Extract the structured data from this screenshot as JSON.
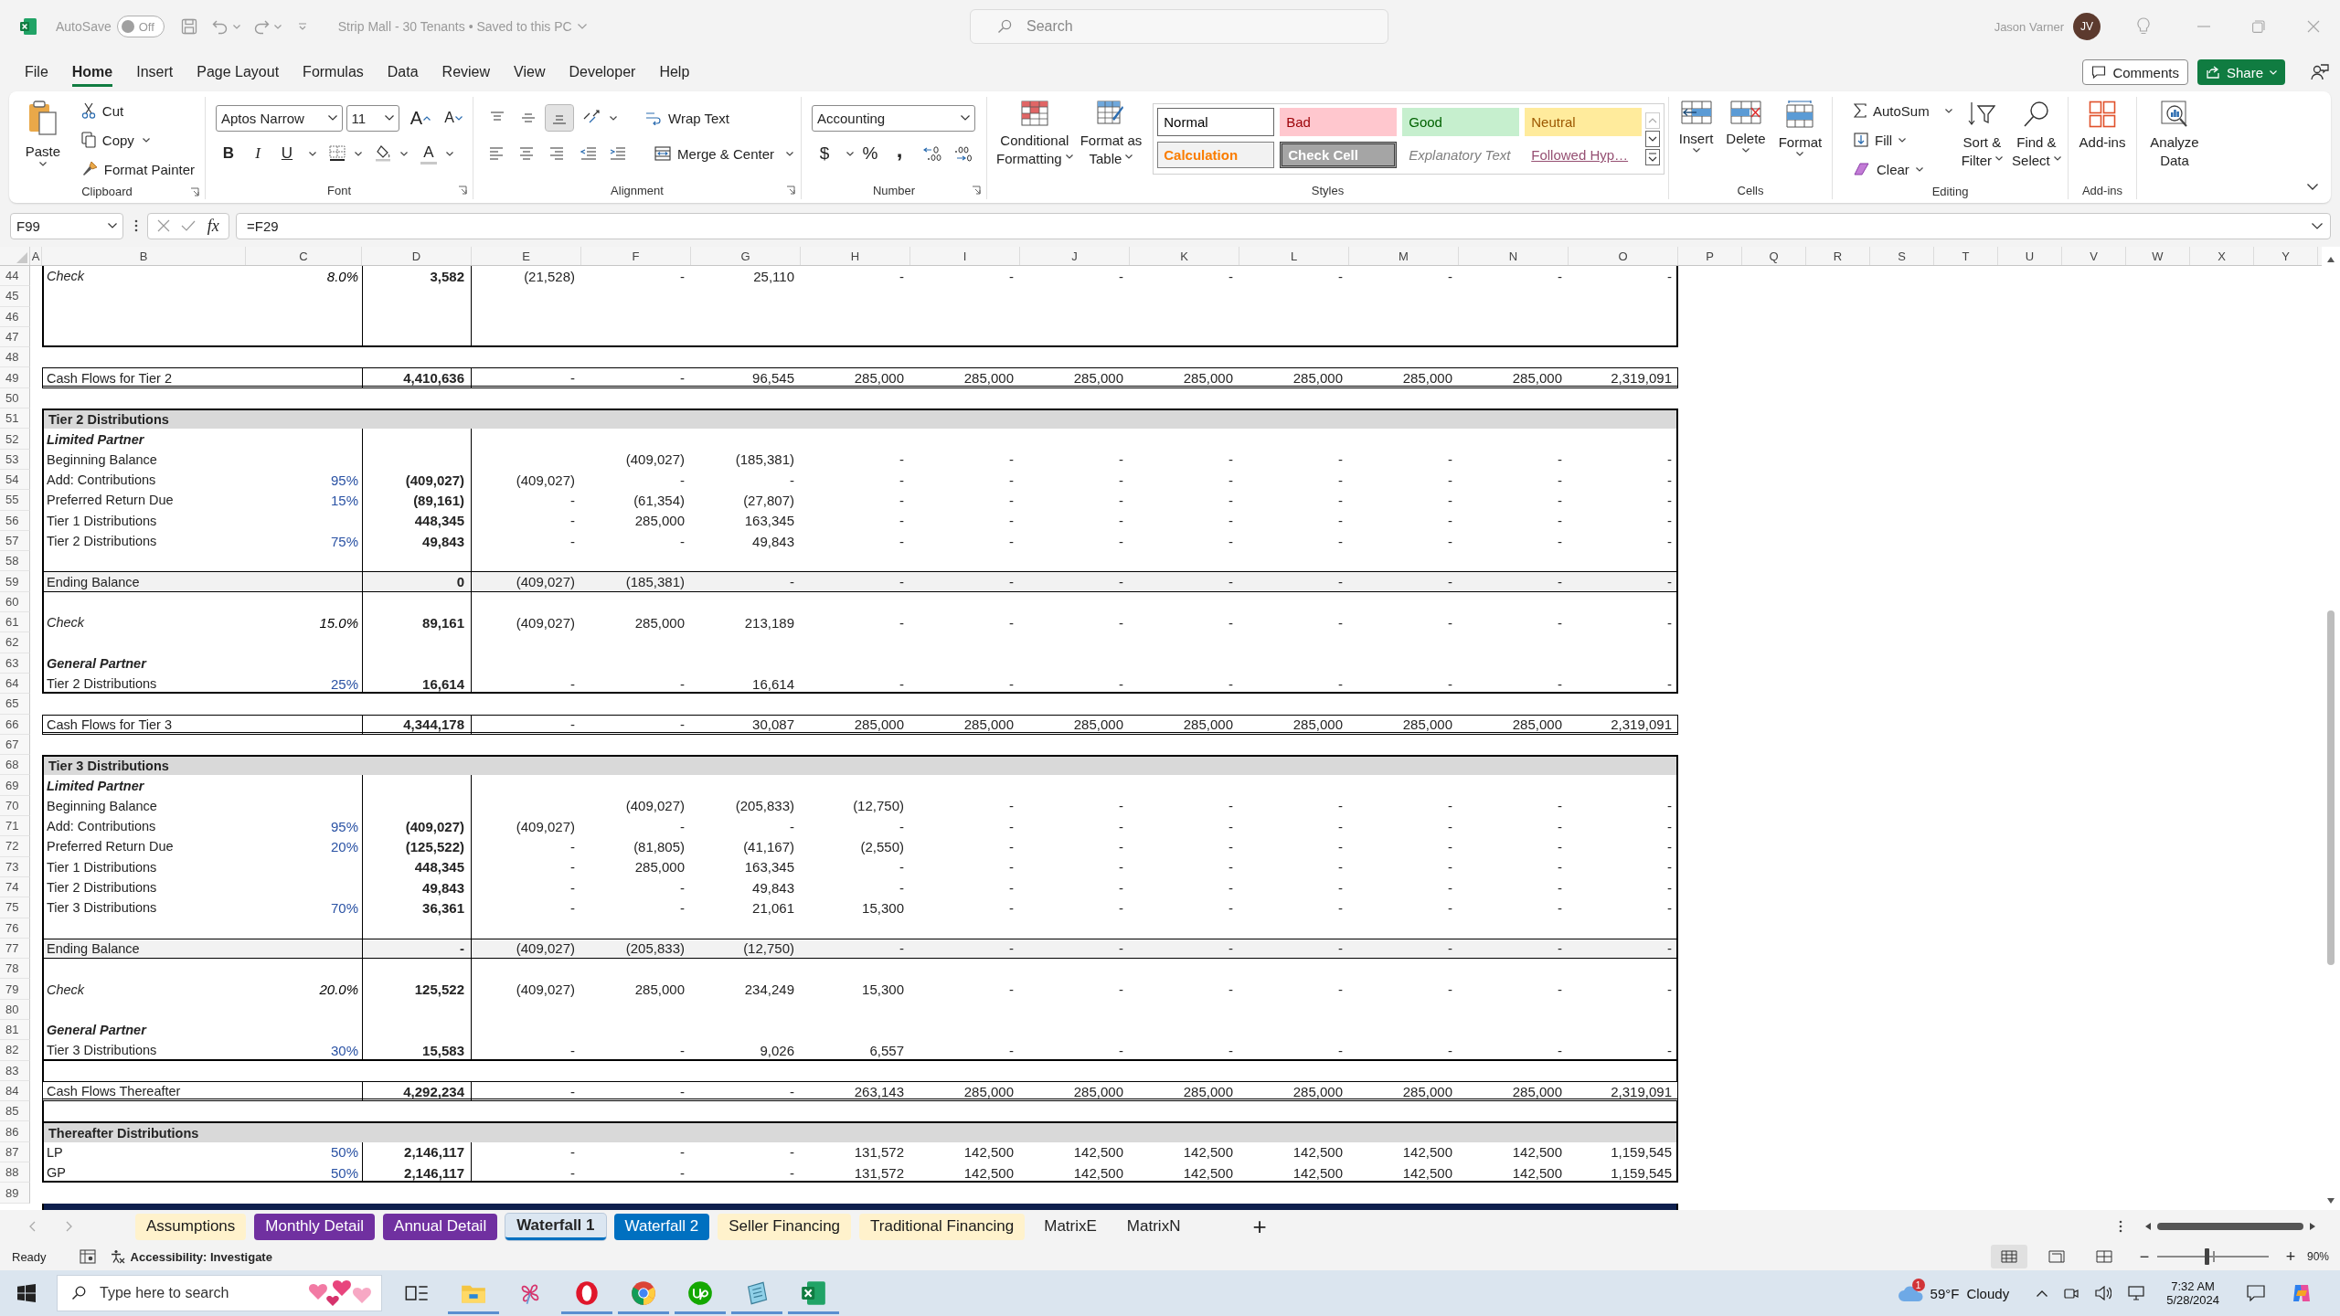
{
  "title_bar": {
    "autosave_label": "AutoSave",
    "autosave_toggle": {
      "on": false,
      "label": "Off"
    },
    "document_title": "Strip Mall - 30 Tenants • Saved to this PC",
    "search": {
      "placeholder": "Search"
    },
    "user_name": "Jason Varner",
    "avatar_initials": "JV"
  },
  "ribbon_tabs": [
    {
      "label": "File",
      "selected": false
    },
    {
      "label": "Home",
      "selected": true
    },
    {
      "label": "Insert",
      "selected": false
    },
    {
      "label": "Page Layout",
      "selected": false
    },
    {
      "label": "Formulas",
      "selected": false
    },
    {
      "label": "Data",
      "selected": false
    },
    {
      "label": "Review",
      "selected": false
    },
    {
      "label": "View",
      "selected": false
    },
    {
      "label": "Developer",
      "selected": false
    },
    {
      "label": "Help",
      "selected": false
    }
  ],
  "header_buttons": {
    "comments": "Comments",
    "share": "Share"
  },
  "ribbon": {
    "clipboard": {
      "label": "Clipboard",
      "paste": "Paste",
      "cut": "Cut",
      "copy": "Copy",
      "format_painter": "Format Painter"
    },
    "font": {
      "label": "Font",
      "font_name": "Aptos Narrow",
      "font_size": "11",
      "grow_glyph": "A",
      "shrink_glyph": "A",
      "bold_glyph": "B",
      "italic_glyph": "I",
      "underline_glyph": "U",
      "color_glyph": "A"
    },
    "alignment": {
      "label": "Alignment",
      "vertical": [
        {
          "kind": "top",
          "selected": false
        },
        {
          "kind": "middle",
          "selected": false
        },
        {
          "kind": "bottom",
          "selected": true
        }
      ],
      "horizontal": [
        {
          "kind": "left",
          "selected": false
        },
        {
          "kind": "center",
          "selected": false
        },
        {
          "kind": "right",
          "selected": false
        }
      ],
      "wrap_text": "Wrap Text",
      "merge_center": "Merge & Center"
    },
    "number": {
      "label": "Number",
      "format": "Accounting",
      "currency_glyph": "$",
      "percent_glyph": "%",
      "comma_glyph": ","
    },
    "conditional_formatting": [
      "Conditional",
      "Formatting"
    ],
    "format_as_table": [
      "Format as",
      "Table"
    ],
    "styles": {
      "label": "Styles",
      "items": [
        {
          "label": "Normal",
          "kind": "normal"
        },
        {
          "label": "Bad",
          "kind": "bad"
        },
        {
          "label": "Good",
          "kind": "good"
        },
        {
          "label": "Neutral",
          "kind": "neutral"
        },
        {
          "label": "Calculation",
          "kind": "calculation"
        },
        {
          "label": "Check Cell",
          "kind": "check"
        },
        {
          "label": "Explanatory Text",
          "kind": "explanatory"
        },
        {
          "label": "Followed Hyp…",
          "kind": "followed"
        }
      ]
    },
    "cells": {
      "label": "Cells",
      "insert": "Insert",
      "delete": "Delete",
      "format": "Format"
    },
    "editing": {
      "label": "Editing",
      "autosum": "AutoSum",
      "fill": "Fill",
      "clear": "Clear",
      "sort_filter": [
        "Sort &",
        "Filter"
      ],
      "find_select": [
        "Find &",
        "Select"
      ]
    },
    "add_ins": {
      "label": "Add-ins",
      "button": "Add-ins"
    },
    "analyze_data": [
      "Analyze",
      "Data"
    ]
  },
  "formula_bar": {
    "name_box": "F99",
    "function_glyph": "fx",
    "formula": "=F29"
  },
  "columns": [
    "A",
    "B",
    "C",
    "D",
    "E",
    "F",
    "G",
    "H",
    "I",
    "J",
    "K",
    "L",
    "M",
    "N",
    "O",
    "P",
    "Q",
    "R",
    "S",
    "T",
    "U",
    "V",
    "W",
    "X",
    "Y"
  ],
  "rows": [
    {
      "number": "44",
      "kind": "check",
      "cells": {
        "B": "Check",
        "C": "8.0%",
        "D": "3,582",
        "E": "(21,528)",
        "F": "-",
        "G": "25,110",
        "H": "-",
        "I": "-",
        "J": "-",
        "K": "-",
        "L": "-",
        "M": "-",
        "N": "-",
        "O": "-"
      }
    },
    {
      "number": "45",
      "kind": "blank"
    },
    {
      "number": "46",
      "kind": "blank"
    },
    {
      "number": "47",
      "kind": "blank"
    },
    {
      "number": "48",
      "kind": "gap"
    },
    {
      "number": "49",
      "kind": "total",
      "cells": {
        "B": "Cash Flows for Tier 2",
        "D": "4,410,636",
        "E": "-",
        "F": "-",
        "G": "96,545",
        "H": "285,000",
        "I": "285,000",
        "J": "285,000",
        "K": "285,000",
        "L": "285,000",
        "M": "285,000",
        "N": "285,000",
        "O": "2,319,091"
      }
    },
    {
      "number": "50",
      "kind": "gap"
    },
    {
      "number": "51",
      "kind": "header",
      "cells": {
        "B": "Tier 2 Distributions"
      }
    },
    {
      "number": "52",
      "kind": "subheader",
      "cells": {
        "B": "Limited Partner"
      }
    },
    {
      "number": "53",
      "kind": "item",
      "cells": {
        "B": "Beginning Balance",
        "F": "(409,027)",
        "G": "(185,381)",
        "H": "-",
        "I": "-",
        "J": "-",
        "K": "-",
        "L": "-",
        "M": "-",
        "N": "-",
        "O": "-"
      }
    },
    {
      "number": "54",
      "kind": "item",
      "cells": {
        "B": "Add: Contributions",
        "C": "95%",
        "D": "(409,027)",
        "E": "(409,027)",
        "F": "-",
        "G": "-",
        "H": "-",
        "I": "-",
        "J": "-",
        "K": "-",
        "L": "-",
        "M": "-",
        "N": "-",
        "O": "-"
      }
    },
    {
      "number": "55",
      "kind": "item",
      "cells": {
        "B": "Preferred Return Due",
        "C": "15%",
        "D": "(89,161)",
        "E": "-",
        "F": "(61,354)",
        "G": "(27,807)",
        "H": "-",
        "I": "-",
        "J": "-",
        "K": "-",
        "L": "-",
        "M": "-",
        "N": "-",
        "O": "-"
      }
    },
    {
      "number": "56",
      "kind": "item",
      "cells": {
        "B": "Tier 1 Distributions",
        "D": "448,345",
        "E": "-",
        "F": "285,000",
        "G": "163,345",
        "H": "-",
        "I": "-",
        "J": "-",
        "K": "-",
        "L": "-",
        "M": "-",
        "N": "-",
        "O": "-"
      }
    },
    {
      "number": "57",
      "kind": "item",
      "cells": {
        "B": "Tier 2 Distributions",
        "C": "75%",
        "D": "49,843",
        "E": "-",
        "F": "-",
        "G": "49,843",
        "H": "-",
        "I": "-",
        "J": "-",
        "K": "-",
        "L": "-",
        "M": "-",
        "N": "-",
        "O": "-"
      }
    },
    {
      "number": "58",
      "kind": "blank"
    },
    {
      "number": "59",
      "kind": "balance",
      "cells": {
        "B": "Ending Balance",
        "D": "0",
        "E": "(409,027)",
        "F": "(185,381)",
        "G": "-",
        "H": "-",
        "I": "-",
        "J": "-",
        "K": "-",
        "L": "-",
        "M": "-",
        "N": "-",
        "O": "-"
      }
    },
    {
      "number": "60",
      "kind": "blank"
    },
    {
      "number": "61",
      "kind": "check",
      "cells": {
        "B": "Check",
        "C": "15.0%",
        "D": "89,161",
        "E": "(409,027)",
        "F": "285,000",
        "G": "213,189",
        "H": "-",
        "I": "-",
        "J": "-",
        "K": "-",
        "L": "-",
        "M": "-",
        "N": "-",
        "O": "-"
      }
    },
    {
      "number": "62",
      "kind": "blank"
    },
    {
      "number": "63",
      "kind": "subheader",
      "cells": {
        "B": "General Partner"
      }
    },
    {
      "number": "64",
      "kind": "item",
      "cells": {
        "B": "Tier 2 Distributions",
        "C": "25%",
        "D": "16,614",
        "E": "-",
        "F": "-",
        "G": "16,614",
        "H": "-",
        "I": "-",
        "J": "-",
        "K": "-",
        "L": "-",
        "M": "-",
        "N": "-",
        "O": "-"
      }
    },
    {
      "number": "65",
      "kind": "gap"
    },
    {
      "number": "66",
      "kind": "total",
      "cells": {
        "B": "Cash Flows for Tier 3",
        "D": "4,344,178",
        "E": "-",
        "F": "-",
        "G": "30,087",
        "H": "285,000",
        "I": "285,000",
        "J": "285,000",
        "K": "285,000",
        "L": "285,000",
        "M": "285,000",
        "N": "285,000",
        "O": "2,319,091"
      }
    },
    {
      "number": "67",
      "kind": "gap"
    },
    {
      "number": "68",
      "kind": "header",
      "cells": {
        "B": "Tier 3 Distributions"
      }
    },
    {
      "number": "69",
      "kind": "subheader",
      "cells": {
        "B": "Limited Partner"
      }
    },
    {
      "number": "70",
      "kind": "item",
      "cells": {
        "B": "Beginning Balance",
        "F": "(409,027)",
        "G": "(205,833)",
        "H": "(12,750)",
        "I": "-",
        "J": "-",
        "K": "-",
        "L": "-",
        "M": "-",
        "N": "-",
        "O": "-"
      }
    },
    {
      "number": "71",
      "kind": "item",
      "cells": {
        "B": "Add: Contributions",
        "C": "95%",
        "D": "(409,027)",
        "E": "(409,027)",
        "F": "-",
        "G": "-",
        "H": "-",
        "I": "-",
        "J": "-",
        "K": "-",
        "L": "-",
        "M": "-",
        "N": "-",
        "O": "-"
      }
    },
    {
      "number": "72",
      "kind": "item",
      "cells": {
        "B": "Preferred Return Due",
        "C": "20%",
        "D": "(125,522)",
        "E": "-",
        "F": "(81,805)",
        "G": "(41,167)",
        "H": "(2,550)",
        "I": "-",
        "J": "-",
        "K": "-",
        "L": "-",
        "M": "-",
        "N": "-",
        "O": "-"
      }
    },
    {
      "number": "73",
      "kind": "item",
      "cells": {
        "B": "Tier 1 Distributions",
        "D": "448,345",
        "E": "-",
        "F": "285,000",
        "G": "163,345",
        "H": "-",
        "I": "-",
        "J": "-",
        "K": "-",
        "L": "-",
        "M": "-",
        "N": "-",
        "O": "-"
      }
    },
    {
      "number": "74",
      "kind": "item",
      "cells": {
        "B": "Tier 2 Distributions",
        "D": "49,843",
        "E": "-",
        "F": "-",
        "G": "49,843",
        "H": "-",
        "I": "-",
        "J": "-",
        "K": "-",
        "L": "-",
        "M": "-",
        "N": "-",
        "O": "-"
      }
    },
    {
      "number": "75",
      "kind": "item",
      "cells": {
        "B": "Tier 3 Distributions",
        "C": "70%",
        "D": "36,361",
        "E": "-",
        "F": "-",
        "G": "21,061",
        "H": "15,300",
        "I": "-",
        "J": "-",
        "K": "-",
        "L": "-",
        "M": "-",
        "N": "-",
        "O": "-"
      }
    },
    {
      "number": "76",
      "kind": "blank"
    },
    {
      "number": "77",
      "kind": "balance",
      "cells": {
        "B": "Ending Balance",
        "D": "-",
        "E": "(409,027)",
        "F": "(205,833)",
        "G": "(12,750)",
        "H": "-",
        "I": "-",
        "J": "-",
        "K": "-",
        "L": "-",
        "M": "-",
        "N": "-",
        "O": "-"
      }
    },
    {
      "number": "78",
      "kind": "blank"
    },
    {
      "number": "79",
      "kind": "check",
      "cells": {
        "B": "Check",
        "C": "20.0%",
        "D": "125,522",
        "E": "(409,027)",
        "F": "285,000",
        "G": "234,249",
        "H": "15,300",
        "I": "-",
        "J": "-",
        "K": "-",
        "L": "-",
        "M": "-",
        "N": "-",
        "O": "-"
      }
    },
    {
      "number": "80",
      "kind": "blank"
    },
    {
      "number": "81",
      "kind": "subheader",
      "cells": {
        "B": "General Partner"
      }
    },
    {
      "number": "82",
      "kind": "item",
      "cells": {
        "B": "Tier 3 Distributions",
        "C": "30%",
        "D": "15,583",
        "E": "-",
        "F": "-",
        "G": "9,026",
        "H": "6,557",
        "I": "-",
        "J": "-",
        "K": "-",
        "L": "-",
        "M": "-",
        "N": "-",
        "O": "-"
      }
    },
    {
      "number": "83",
      "kind": "spacer"
    },
    {
      "number": "84",
      "kind": "total",
      "cells": {
        "B": "Cash Flows Thereafter",
        "D": "4,292,234",
        "E": "-",
        "F": "-",
        "G": "-",
        "H": "263,143",
        "I": "285,000",
        "J": "285,000",
        "K": "285,000",
        "L": "285,000",
        "M": "285,000",
        "N": "285,000",
        "O": "2,319,091"
      }
    },
    {
      "number": "85",
      "kind": "spacer"
    },
    {
      "number": "86",
      "kind": "header",
      "cells": {
        "B": "Thereafter Distributions"
      }
    },
    {
      "number": "87",
      "kind": "item",
      "cells": {
        "B": "LP",
        "C": "50%",
        "D": "2,146,117",
        "E": "-",
        "F": "-",
        "G": "-",
        "H": "131,572",
        "I": "142,500",
        "J": "142,500",
        "K": "142,500",
        "L": "142,500",
        "M": "142,500",
        "N": "142,500",
        "O": "1,159,545"
      }
    },
    {
      "number": "88",
      "kind": "item",
      "cells": {
        "B": "GP",
        "C": "50%",
        "D": "2,146,117",
        "E": "-",
        "F": "-",
        "G": "-",
        "H": "131,572",
        "I": "142,500",
        "J": "142,500",
        "K": "142,500",
        "L": "142,500",
        "M": "142,500",
        "N": "142,500",
        "O": "1,159,545"
      }
    },
    {
      "number": "89",
      "kind": "gap"
    },
    {
      "kind": "band"
    }
  ],
  "sheet_tabs": [
    {
      "label": "Assumptions",
      "selected": false,
      "color": "#fff2cc"
    },
    {
      "label": "Monthly Detail",
      "selected": false,
      "color": "#7030a0"
    },
    {
      "label": "Annual Detail",
      "selected": false,
      "color": "#7030a0"
    },
    {
      "label": "Waterfall 1",
      "selected": true,
      "color": "#0070c0"
    },
    {
      "label": "Waterfall 2",
      "selected": false,
      "color": "#0070c0"
    },
    {
      "label": "Seller Financing",
      "selected": false,
      "color": "#fff2cc"
    },
    {
      "label": "Traditional Financing",
      "selected": false,
      "color": "#fff2cc"
    },
    {
      "label": "MatrixE",
      "selected": false
    },
    {
      "label": "MatrixN",
      "selected": false
    }
  ],
  "new_sheet": "+",
  "status_bar": {
    "mode": "Ready",
    "accessibility": "Accessibility: Investigate",
    "views": [
      {
        "kind": "normal",
        "selected": true
      },
      {
        "kind": "page_layout",
        "selected": false
      },
      {
        "kind": "page_break",
        "selected": false
      }
    ],
    "zoom_out": "−",
    "zoom_in": "+",
    "zoom": {
      "level": 0.44,
      "label": "90%"
    }
  },
  "taskbar": {
    "search": {
      "placeholder": "Type here to search"
    },
    "apps": [
      {
        "kind": "task_view",
        "running": false
      },
      {
        "kind": "folder",
        "running": true
      },
      {
        "kind": "flower",
        "running": false
      },
      {
        "kind": "ring",
        "running": true
      },
      {
        "kind": "round_logo",
        "running": true
      },
      {
        "kind": "disc",
        "running": true
      },
      {
        "kind": "notepad",
        "running": true
      },
      {
        "kind": "spreadsheet",
        "running": true
      }
    ],
    "weather": {
      "badge": "1",
      "temperature": "59°F",
      "condition": "Cloudy"
    },
    "time": "7:32 AM",
    "date": "5/28/2024"
  }
}
